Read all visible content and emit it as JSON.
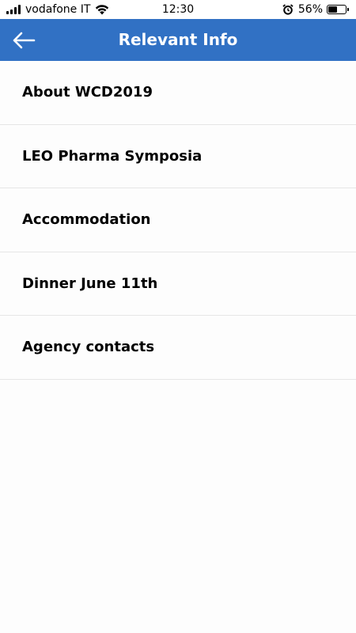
{
  "status_bar": {
    "carrier": "vodafone IT",
    "time": "12:30",
    "battery_percent_label": "56%",
    "battery_level": 0.56,
    "icons": [
      "signal-icon",
      "wifi-icon",
      "alarm-icon",
      "battery-icon"
    ]
  },
  "header": {
    "title": "Relevant Info",
    "back_icon": "arrow-left-icon",
    "background_color": "#3171c4"
  },
  "menu": {
    "items": [
      {
        "label": "About WCD2019"
      },
      {
        "label": "LEO Pharma Symposia"
      },
      {
        "label": "Accommodation"
      },
      {
        "label": "Dinner June 11th"
      },
      {
        "label": "Agency contacts"
      }
    ]
  }
}
